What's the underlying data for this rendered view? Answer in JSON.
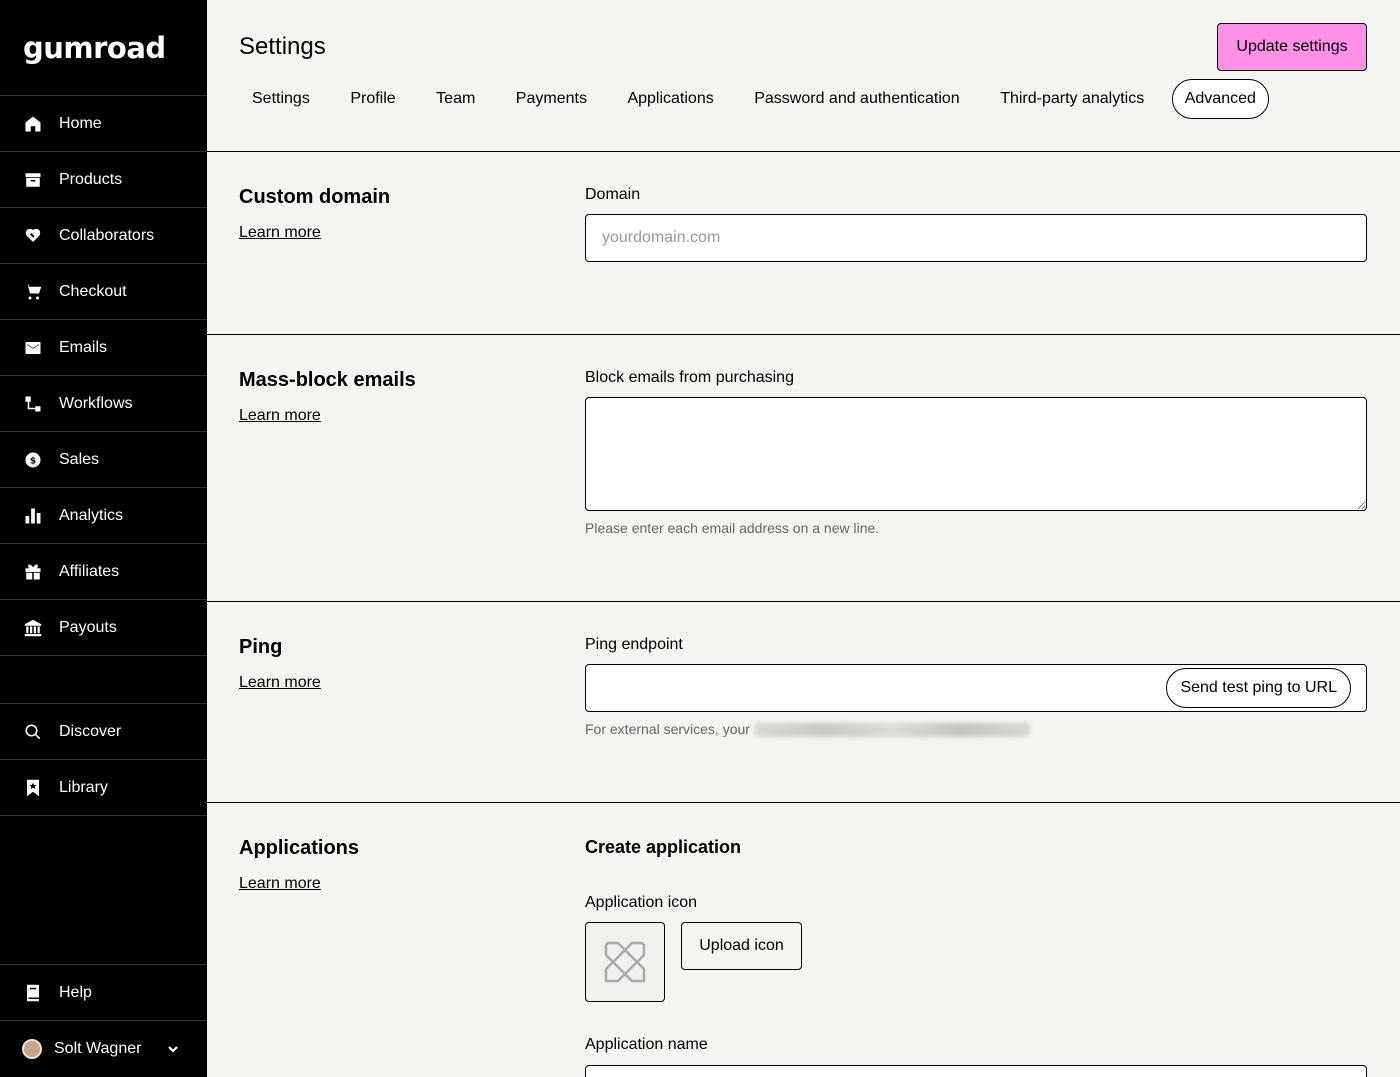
{
  "brand": {
    "logo_text": "Gumroad",
    "accent_color": "#ff90e8"
  },
  "sidebar": {
    "items": [
      {
        "label": "Home",
        "icon": "home-icon"
      },
      {
        "label": "Products",
        "icon": "archive-icon"
      },
      {
        "label": "Collaborators",
        "icon": "handshake-icon"
      },
      {
        "label": "Checkout",
        "icon": "cart-icon"
      },
      {
        "label": "Emails",
        "icon": "envelope-icon"
      },
      {
        "label": "Workflows",
        "icon": "workflow-icon"
      },
      {
        "label": "Sales",
        "icon": "dollar-circle-icon"
      },
      {
        "label": "Analytics",
        "icon": "bar-chart-icon"
      },
      {
        "label": "Affiliates",
        "icon": "gift-icon"
      },
      {
        "label": "Payouts",
        "icon": "bank-icon"
      }
    ],
    "secondary": [
      {
        "label": "Discover",
        "icon": "search-icon"
      },
      {
        "label": "Library",
        "icon": "bookmark-icon"
      }
    ],
    "help": {
      "label": "Help",
      "icon": "book-icon"
    },
    "user": {
      "name": "Solt Wagner"
    }
  },
  "header": {
    "title": "Settings",
    "update_button": "Update settings",
    "tabs": [
      {
        "label": "Settings"
      },
      {
        "label": "Profile"
      },
      {
        "label": "Team"
      },
      {
        "label": "Payments"
      },
      {
        "label": "Applications"
      },
      {
        "label": "Password and authentication"
      },
      {
        "label": "Third-party analytics"
      },
      {
        "label": "Advanced",
        "active": true
      }
    ]
  },
  "sections": {
    "custom_domain": {
      "title": "Custom domain",
      "learn_more": "Learn more",
      "field_label": "Domain",
      "placeholder": "yourdomain.com",
      "value": ""
    },
    "mass_block": {
      "title": "Mass-block emails",
      "learn_more": "Learn more",
      "field_label": "Block emails from purchasing",
      "value": "",
      "hint": "Please enter each email address on a new line."
    },
    "ping": {
      "title": "Ping",
      "learn_more": "Learn more",
      "field_label": "Ping endpoint",
      "value": "",
      "button": "Send test ping to URL",
      "hint": "For external services, your"
    },
    "applications": {
      "title": "Applications",
      "learn_more": "Learn more",
      "subheading": "Create application",
      "icon_label": "Application icon",
      "upload_button": "Upload icon",
      "name_label": "Application name"
    }
  }
}
